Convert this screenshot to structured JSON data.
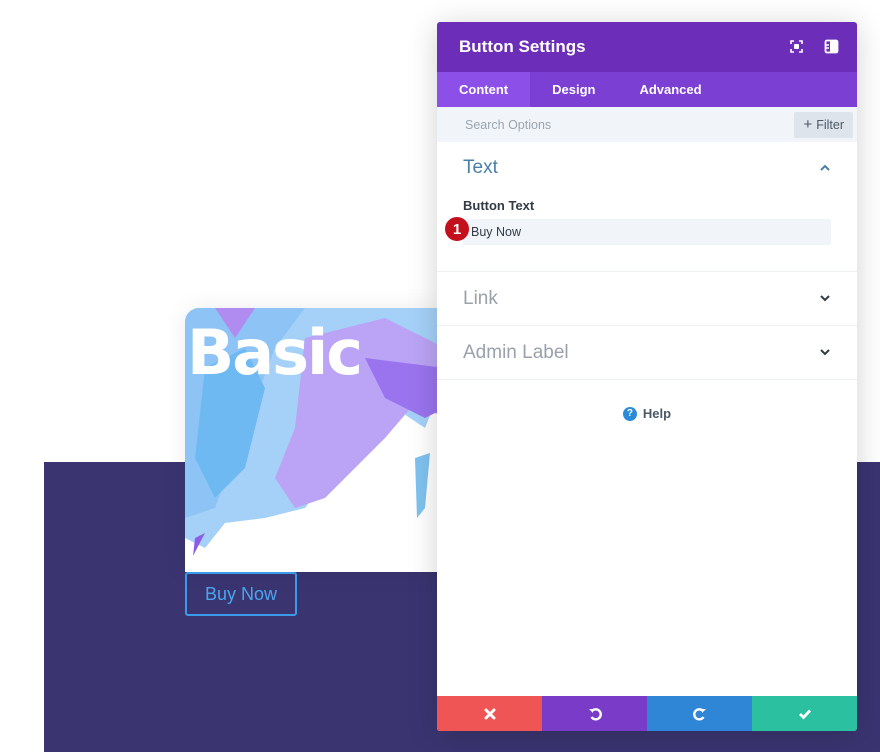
{
  "background": {
    "section_color": "#3a3571"
  },
  "preview": {
    "card_title": "Basic",
    "button_label": "Buy Now"
  },
  "panel": {
    "title": "Button Settings",
    "header_icons": [
      "fullscreen-icon",
      "split-view-icon"
    ],
    "tabs": [
      {
        "label": "Content",
        "active": true
      },
      {
        "label": "Design",
        "active": false
      },
      {
        "label": "Advanced",
        "active": false
      }
    ],
    "search": {
      "placeholder": "Search Options"
    },
    "filter_label": "Filter",
    "sections": {
      "text": {
        "title": "Text",
        "expanded": true,
        "field_label": "Button Text",
        "field_value": "Buy Now",
        "badge": "1"
      },
      "link": {
        "title": "Link",
        "expanded": false
      },
      "admin": {
        "title": "Admin Label",
        "expanded": false
      }
    },
    "help_label": "Help",
    "footer": {
      "cancel": "close-icon",
      "undo": "undo-icon",
      "redo": "redo-icon",
      "save": "check-icon"
    },
    "colors": {
      "header": "#6c2eb9",
      "tabs": "#7b3fd4",
      "cancel": "#ef5555",
      "undo": "#7b3bc9",
      "redo": "#2f86d6",
      "save": "#2bc0a0"
    }
  }
}
